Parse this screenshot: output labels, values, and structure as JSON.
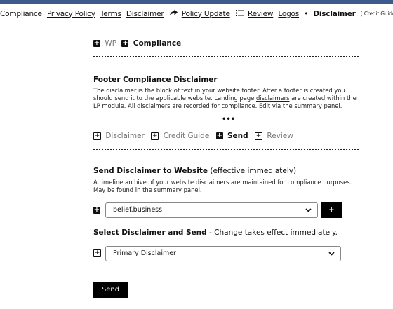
{
  "nav": {
    "items": [
      "Compliance",
      "Privacy Policy",
      "Terms",
      "Disclaimer"
    ],
    "policy_update": "Policy Update",
    "review": "Review",
    "logos": "Logos",
    "current": "Disclaimer",
    "tag": "[ Credit Guide ]",
    "bullet": "•"
  },
  "crumbs": {
    "wp": "WP",
    "compliance": "Compliance"
  },
  "footer_section": {
    "heading": "Footer Compliance Disclaimer",
    "text_1": "The disclaimer is the block of text in your website footer. After a footer is created you should send it to the applicable website. Landing page ",
    "link_1": "disclaimers",
    "text_2": " are created within the LP module. All disclaimers are recorded for compliance. Edit via the ",
    "link_2": "summary",
    "text_3": " panel.",
    "ellipsis": "•••"
  },
  "tabs": [
    {
      "label": "Disclaimer",
      "active": false
    },
    {
      "label": "Credit Guide",
      "active": false
    },
    {
      "label": "Send",
      "active": true
    },
    {
      "label": "Review",
      "active": false
    }
  ],
  "send_section": {
    "heading": "Send Disclaimer to Website",
    "heading_note": "(effective immediately)",
    "text_1": "A timeline archive of your website disclaimers are maintained for compliance purposes. May be found in the ",
    "link": "summary panel",
    "text_2": "."
  },
  "website_select": {
    "value": "belief.business",
    "add_label": "+"
  },
  "select_section": {
    "heading": "Select Disclaimer and Send",
    "note": " - Change takes effect immediately."
  },
  "disclaimer_select": {
    "value": "Primary Disclaimer"
  },
  "send_button": "Send",
  "icons": {
    "plus_box": "+",
    "chevron": "⌄"
  },
  "colors": {
    "topbar": "#3d5a8f"
  }
}
